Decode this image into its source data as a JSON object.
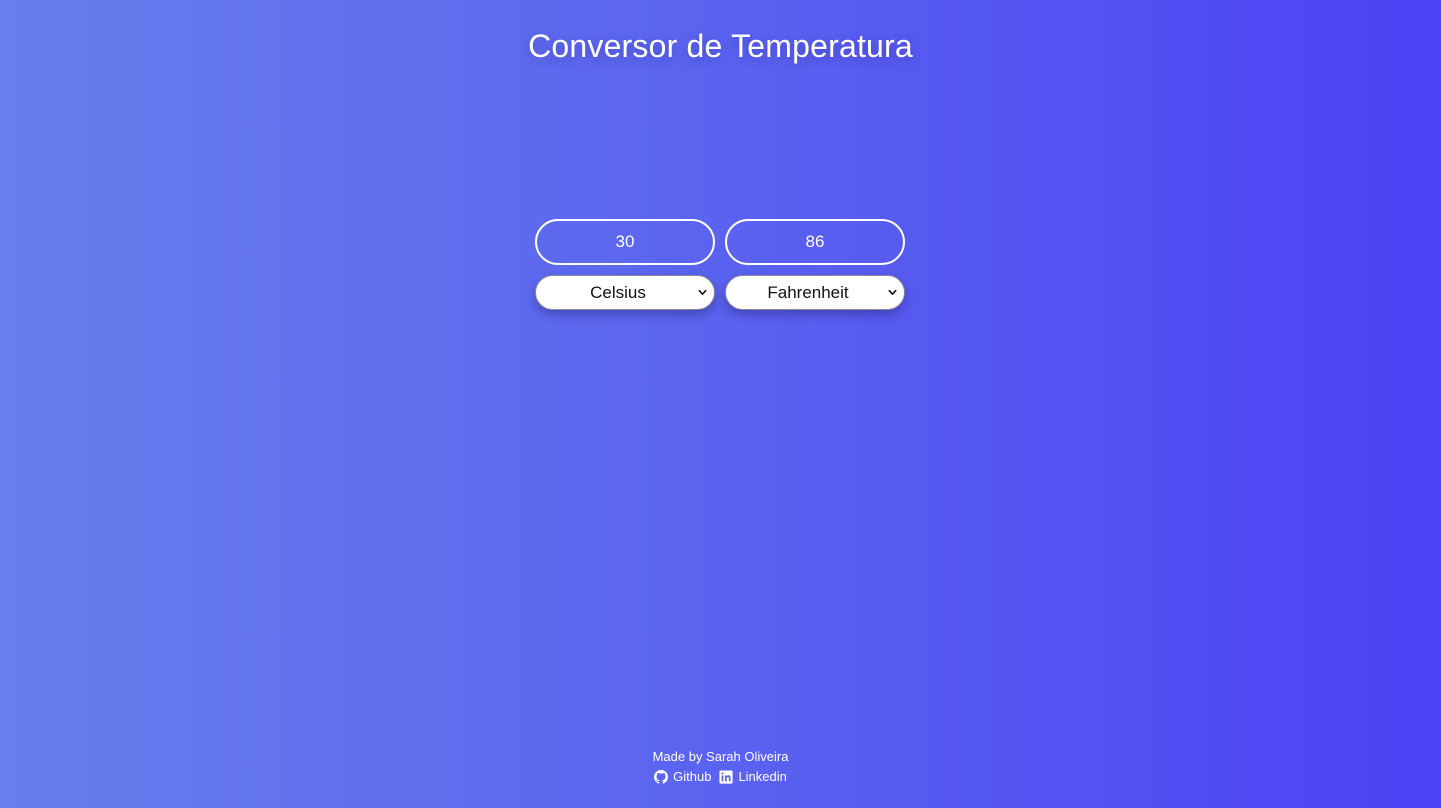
{
  "page": {
    "title": "Conversor de Temperatura"
  },
  "converter": {
    "input_value": "30",
    "output_value": "86",
    "from_unit": {
      "selected": "Celsius",
      "options": [
        "Celsius"
      ]
    },
    "to_unit": {
      "selected": "Fahrenheit",
      "options": [
        "Fahrenheit"
      ]
    }
  },
  "footer": {
    "credit": "Made by Sarah Oliveira",
    "links": [
      {
        "label": "Github",
        "icon": "github-icon"
      },
      {
        "label": "Linkedin",
        "icon": "linkedin-icon"
      }
    ]
  },
  "colors": {
    "gradient_start": "#687eec",
    "gradient_end": "#4c42f5",
    "text": "#ffffff"
  }
}
